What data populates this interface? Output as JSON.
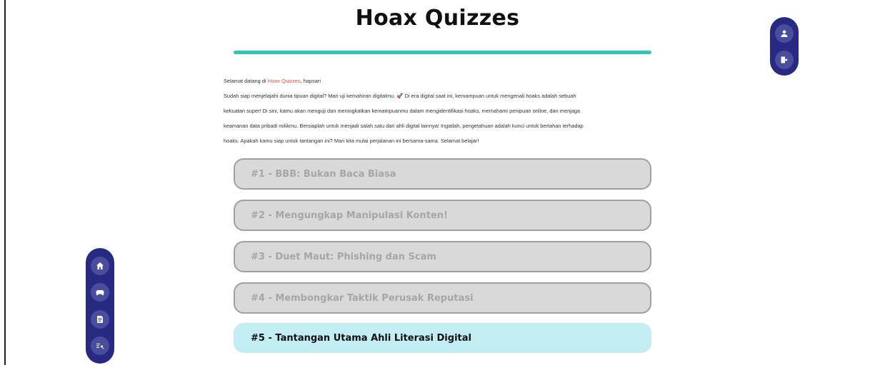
{
  "header": {
    "title": "Hoax Quizzes"
  },
  "intro": {
    "greeting_prefix": "Selamat datang di ",
    "greeting_link": "Hoax Quizzes",
    "greeting_suffix": ", hapsari",
    "lines": [
      "Sudah siap menjelajahi dunia tipuan digital? Mari uji kemahiran digitalmu. 🚀 Di era digital saat ini, kemampuan untuk mengenali hoaks adalah sebuah",
      "kekuatan super! Di sini, kamu akan menguji dan meningkatkan kemampuanmu dalam mengidentifikasi hoaks, memahami penipuan online, dan menjaga",
      "keamanan data pribadi milikmu. Bersiaplah untuk menjadi salah satu dari ahli digital lainnya! Ingatlah, pengetahuan adalah kunci untuk bertahan terhadap",
      "hoaks. Apakah kamu siap untuk tantangan ini? Mari kita mulai perjalanan ini bersama-sama. Selamat belajar!"
    ]
  },
  "quizzes": [
    {
      "label": "#1 - BBB: Bukan Baca Biasa",
      "state": "locked"
    },
    {
      "label": "#2 - Mengungkap Manipulasi Konten!",
      "state": "locked"
    },
    {
      "label": "#3 - Duet Maut: Phishing dan Scam",
      "state": "locked"
    },
    {
      "label": "#4 - Membongkar Taktik Perusak Reputasi",
      "state": "locked"
    },
    {
      "label": "#5 - Tantangan Utama Ahli Literasi Digital",
      "state": "active"
    }
  ],
  "side_nav": {
    "icons": [
      "home-icon",
      "gamepad-icon",
      "document-icon",
      "search-list-icon"
    ]
  },
  "user_nav": {
    "icons": [
      "user-icon",
      "logout-icon"
    ]
  },
  "colors": {
    "accent_bar": "#2ec6b6",
    "nav_bg": "#272982",
    "nav_button": "#4a4c9e",
    "active_quiz_bg": "#c2edf3",
    "locked_quiz_bg": "#d9d9d9",
    "link_accent": "#e5533c"
  }
}
